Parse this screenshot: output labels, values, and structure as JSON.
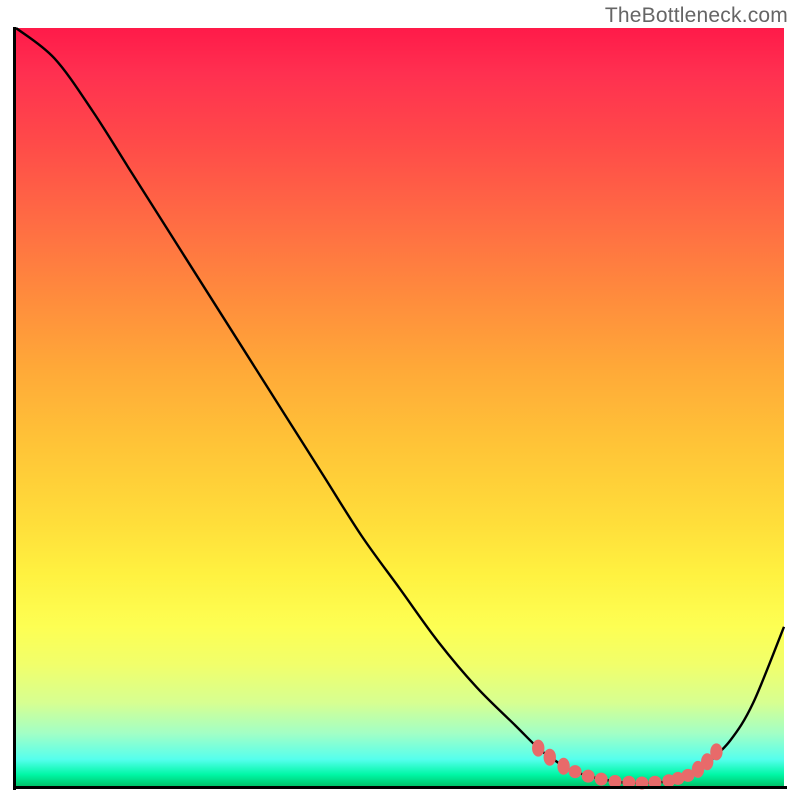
{
  "attribution": "TheBottleneck.com",
  "chart_data": {
    "type": "line",
    "title": "",
    "xlabel": "",
    "ylabel": "",
    "xlim": [
      0,
      100
    ],
    "ylim": [
      0,
      100
    ],
    "background_gradient": {
      "top": "#ff1a49",
      "middle": "#ffdd3a",
      "bottom": "#00c46a"
    },
    "series": [
      {
        "name": "bottleneck-curve",
        "x": [
          0,
          5,
          10,
          15,
          20,
          25,
          30,
          35,
          40,
          45,
          50,
          55,
          60,
          65,
          68,
          70,
          72,
          75,
          78,
          80,
          82,
          84,
          86,
          88,
          90,
          93,
          96,
          100
        ],
        "y": [
          100,
          96,
          89,
          81,
          73,
          65,
          57,
          49,
          41,
          33,
          26,
          19,
          13,
          8,
          5,
          3.5,
          2.2,
          1.2,
          0.6,
          0.4,
          0.4,
          0.5,
          0.8,
          1.5,
          3,
          6,
          11,
          21
        ]
      }
    ],
    "markers": {
      "name": "highlight-dots",
      "color": "#e86a6a",
      "points": [
        {
          "x": 68,
          "y": 5.0
        },
        {
          "x": 69.5,
          "y": 3.8
        },
        {
          "x": 71.3,
          "y": 2.6
        },
        {
          "x": 72.8,
          "y": 1.9
        },
        {
          "x": 74.5,
          "y": 1.3
        },
        {
          "x": 76.2,
          "y": 0.9
        },
        {
          "x": 78.0,
          "y": 0.6
        },
        {
          "x": 79.8,
          "y": 0.5
        },
        {
          "x": 81.5,
          "y": 0.4
        },
        {
          "x": 83.2,
          "y": 0.5
        },
        {
          "x": 85.0,
          "y": 0.7
        },
        {
          "x": 86.2,
          "y": 1.0
        },
        {
          "x": 87.5,
          "y": 1.4
        },
        {
          "x": 88.8,
          "y": 2.2
        },
        {
          "x": 90.0,
          "y": 3.2
        },
        {
          "x": 91.2,
          "y": 4.5
        }
      ]
    }
  }
}
